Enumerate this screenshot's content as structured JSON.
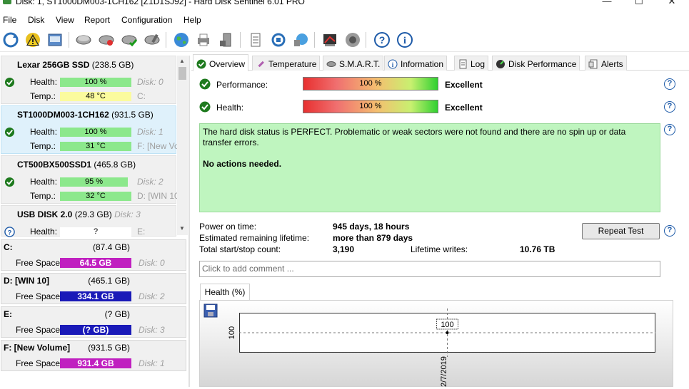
{
  "window": {
    "title": "Disk: 1, ST1000DM003-1CH162 [Z1D1SJ92] - Hard Disk Sentinel 6.01 PRO",
    "minimize": "—",
    "maximize": "☐",
    "close": "✕"
  },
  "menu": [
    "File",
    "Disk",
    "View",
    "Report",
    "Configuration",
    "Help"
  ],
  "disks": [
    {
      "name": "Lexar 256GB SSD",
      "size": "(238.5 GB)",
      "health_label": "Health:",
      "health": "100 %",
      "health_pct": 100,
      "disk": "Disk: 0",
      "temp_label": "Temp.:",
      "temp": "48 °C",
      "temp_color": "yellow",
      "drive": "C:"
    },
    {
      "name": "ST1000DM003-1CH162",
      "size": "(931.5 GB)",
      "health_label": "Health:",
      "health": "100 %",
      "health_pct": 100,
      "disk": "Disk: 1",
      "temp_label": "Temp.:",
      "temp": "31 °C",
      "temp_color": "green",
      "drive": "F: [New Vo"
    },
    {
      "name": "CT500BX500SSD1",
      "size": "(465.8 GB)",
      "health_label": "Health:",
      "health": "95 %",
      "health_pct": 95,
      "disk": "Disk: 2",
      "temp_label": "Temp.:",
      "temp": "32 °C",
      "temp_color": "green",
      "drive": "D: [WIN 10"
    },
    {
      "name": "USB DISK 2.0",
      "size": "(29.3 GB)",
      "disk": "Disk: 3",
      "health_label": "Health:",
      "health": "?",
      "drive": "E:"
    }
  ],
  "volumes": [
    {
      "name": "C:",
      "size": "(87.4 GB)",
      "free_label": "Free Space",
      "free": "64.5 GB",
      "free_color": "#c020c0",
      "disk": "Disk: 0"
    },
    {
      "name": "D: [WIN 10]",
      "size": "(465.1 GB)",
      "free_label": "Free Space",
      "free": "334.1 GB",
      "free_color": "#1a1ab8",
      "disk": "Disk: 2"
    },
    {
      "name": "E:",
      "size": "(? GB)",
      "free_label": "Free Space",
      "free": "(? GB)",
      "free_color": "#1a1ab8",
      "disk": "Disk: 3"
    },
    {
      "name": "F: [New Volume]",
      "size": "(931.5 GB)",
      "free_label": "Free Space",
      "free": "931.4 GB",
      "free_color": "#c020c0",
      "disk": "Disk: 1"
    }
  ],
  "tabs": [
    "Overview",
    "Temperature",
    "S.M.A.R.T.",
    "Information",
    "Log",
    "Disk Performance",
    "Alerts"
  ],
  "overview": {
    "performance_label": "Performance:",
    "performance_value": "100 %",
    "performance_rating": "Excellent",
    "health_label": "Health:",
    "health_value": "100 %",
    "health_rating": "Excellent",
    "status_text": "The hard disk status is PERFECT. Problematic or weak sectors were not found and there are no spin up or data transfer errors.",
    "actions_text": "No actions needed.",
    "power_on_label": "Power on time:",
    "power_on_value": "945 days, 18 hours",
    "remaining_label": "Estimated remaining lifetime:",
    "remaining_value": "more than 879 days",
    "startstop_label": "Total start/stop count:",
    "startstop_value": "3,190",
    "writes_label": "Lifetime writes:",
    "writes_value": "10.76 TB",
    "repeat_button": "Repeat Test",
    "comment_placeholder": "Click to add comment ...",
    "health_tab": "Health (%)"
  },
  "chart_data": {
    "type": "line",
    "x": [
      "2/7/2019"
    ],
    "series": [
      {
        "values": [
          100
        ]
      }
    ],
    "point_labels": [
      "100"
    ],
    "yticks": [
      "100"
    ],
    "xlabel": "",
    "ylabel": ""
  },
  "colors": {
    "status_green": "#bff5bf",
    "health_green": "#8ce88c",
    "temp_yellow": "#fbfb9e",
    "selected_blue": "#dff1fb"
  }
}
